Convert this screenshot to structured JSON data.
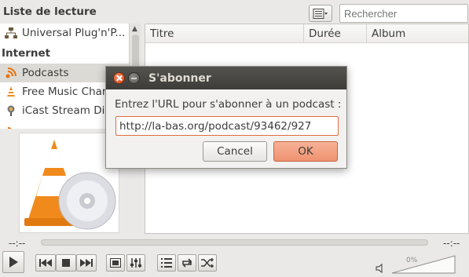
{
  "header": {
    "title": "Liste de lecture",
    "search_placeholder": "Rechercher"
  },
  "sidebar": {
    "items": [
      {
        "label": "Universal Plug'n'P...",
        "icon": "upnp-network-icon"
      },
      {
        "label": "Podcasts",
        "icon": "podcast-icon"
      },
      {
        "label": "Free Music Charts",
        "icon": "vlc-cone-icon"
      },
      {
        "label": "iCast Stream Directory",
        "icon": "icast-icon"
      }
    ],
    "category_internet": "Internet"
  },
  "table": {
    "columns": [
      "Titre",
      "Durée",
      "Album"
    ]
  },
  "player": {
    "elapsed": "--:--",
    "remaining": "--:--",
    "volume_label": "0%"
  },
  "dialog": {
    "title": "S'abonner",
    "prompt": "Entrez l'URL pour s'abonner à un podcast :",
    "url_value": "http://la-bas.org/podcast/93462/927",
    "cancel_label": "Cancel",
    "ok_label": "OK"
  },
  "colors": {
    "accent": "#e06b3f",
    "titlebar": "#3d3c39",
    "ok_button": "#ef9270"
  }
}
